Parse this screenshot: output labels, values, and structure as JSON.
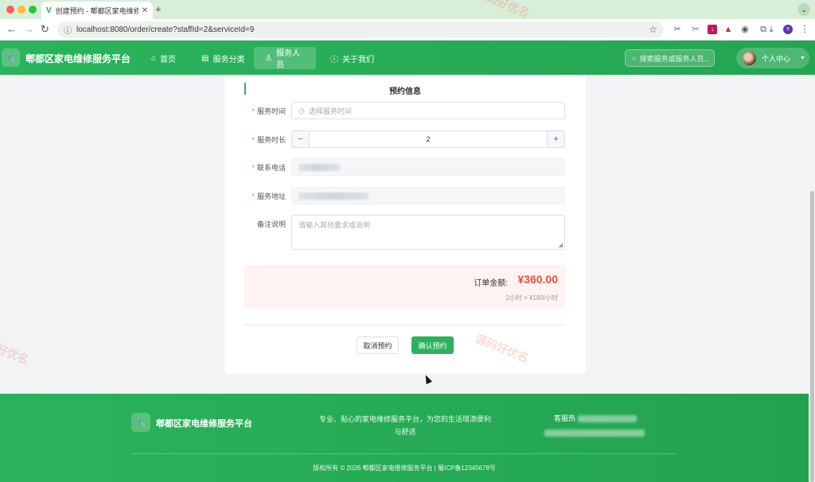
{
  "browser": {
    "tab_title": "创建预约 - 郫都区家电维修服务平",
    "tab_close": "✕",
    "new_tab": "+",
    "url": "localhost:8080/order/create?staffId=2&serviceId=9",
    "colors": {
      "close": "#ff5f57",
      "minimize": "#febc2e",
      "maximize": "#28c840"
    }
  },
  "header": {
    "brand": "郫都区家电维修服务平台",
    "logo_icon": "wrench-icon",
    "nav": [
      {
        "label": "首页",
        "icon": "home-icon"
      },
      {
        "label": "服务分类",
        "icon": "list-icon"
      },
      {
        "label": "服务人员",
        "icon": "user-icon"
      },
      {
        "label": "关于我们",
        "icon": "info-icon"
      }
    ],
    "active_nav": "服务人员",
    "search_placeholder": "搜索服务或服务人员...",
    "user_center": "个人中心"
  },
  "form": {
    "section_title": "预约信息",
    "service_time": {
      "label": "服务时间",
      "placeholder": "选择服务时间",
      "required": true
    },
    "duration": {
      "label": "服务时长",
      "value": "2",
      "minus": "−",
      "plus": "+",
      "required": true
    },
    "phone": {
      "label": "联系电话",
      "required": true
    },
    "address": {
      "label": "服务地址",
      "required": true
    },
    "remark": {
      "label": "备注说明",
      "placeholder": "请输入其他要求或说明"
    }
  },
  "order": {
    "amount_label": "订单金额:",
    "amount": "¥360.00",
    "formula": "2小时 × ¥180/小时"
  },
  "actions": {
    "cancel": "取消预约",
    "confirm": "确认预约"
  },
  "footer": {
    "brand": "郫都区家电维修服务平台",
    "description": "专业、贴心的家电维修服务平台，为您的生活增添便利与舒适",
    "contact_prefix": "客服热",
    "copyright": "版权所有 © 2026 郫都区家电维修服务平台 | 蜀ICP备12345678号"
  },
  "watermark": "源码好优名",
  "theme": {
    "accent": "#2bb35c",
    "price": "#e4513f"
  }
}
